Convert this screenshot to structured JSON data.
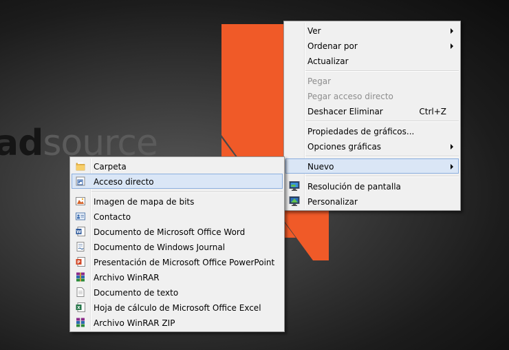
{
  "wallpaper": {
    "brand_dark": "ad",
    "brand_light": "source",
    "accent_color": "#f05a28"
  },
  "context_menu": {
    "items": [
      {
        "label": "Ver",
        "submenu": true
      },
      {
        "label": "Ordenar por",
        "submenu": true
      },
      {
        "label": "Actualizar"
      },
      {
        "label": "Pegar",
        "disabled": true
      },
      {
        "label": "Pegar acceso directo",
        "disabled": true
      },
      {
        "label": "Deshacer Eliminar",
        "shortcut": "Ctrl+Z"
      },
      {
        "label": "Propiedades de gráficos..."
      },
      {
        "label": "Opciones gráficas",
        "submenu": true
      },
      {
        "label": "Nuevo",
        "submenu": true,
        "highlighted": true
      },
      {
        "label": "Resolución de pantalla",
        "icon": "monitor-icon"
      },
      {
        "label": "Personalizar",
        "icon": "personalize-monitor-icon"
      }
    ]
  },
  "new_submenu": {
    "items": [
      {
        "label": "Carpeta",
        "icon": "folder-icon"
      },
      {
        "label": "Acceso directo",
        "icon": "shortcut-icon",
        "highlighted": true
      },
      {
        "label": "Imagen de mapa de bits",
        "icon": "bitmap-icon"
      },
      {
        "label": "Contacto",
        "icon": "contact-icon"
      },
      {
        "label": "Documento de Microsoft Office Word",
        "icon": "word-document-icon"
      },
      {
        "label": "Documento de Windows Journal",
        "icon": "journal-document-icon"
      },
      {
        "label": "Presentación de Microsoft Office PowerPoint",
        "icon": "powerpoint-icon"
      },
      {
        "label": "Archivo WinRAR",
        "icon": "winrar-icon"
      },
      {
        "label": "Documento de texto",
        "icon": "text-document-icon"
      },
      {
        "label": "Hoja de cálculo de Microsoft Office Excel",
        "icon": "excel-icon"
      },
      {
        "label": "Archivo WinRAR ZIP",
        "icon": "winrar-zip-icon"
      }
    ]
  }
}
